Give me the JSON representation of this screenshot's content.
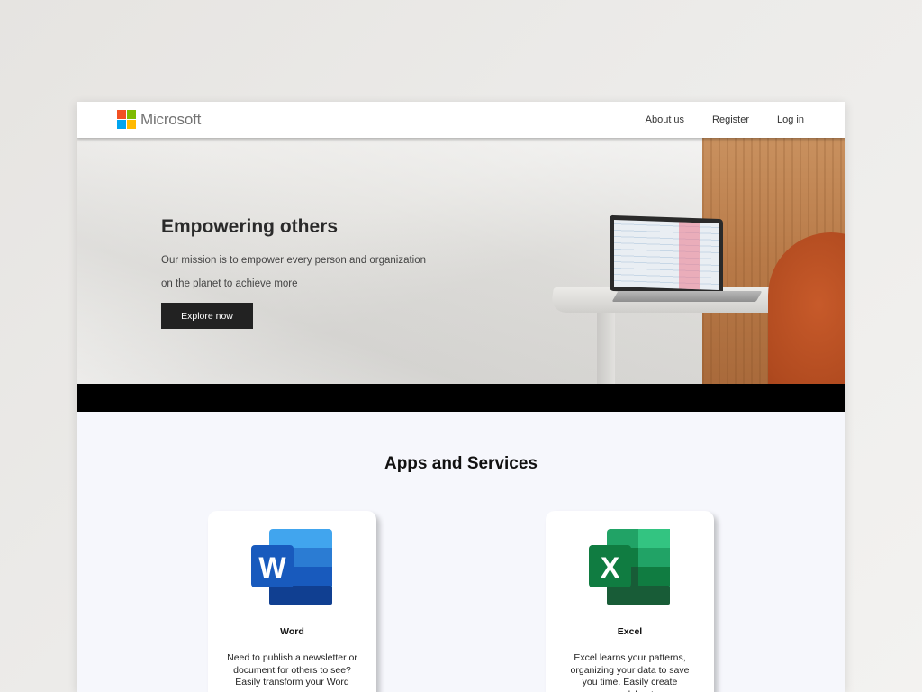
{
  "header": {
    "brand": "Microsoft",
    "logo_colors": [
      "#f25022",
      "#7fba00",
      "#00a4ef",
      "#ffb900"
    ],
    "nav": [
      "About us",
      "Register",
      "Log in"
    ]
  },
  "hero": {
    "title": "Empowering others",
    "line1": "Our mission is to empower every person and organization",
    "line2": "on the planet to achieve more",
    "button": "Explore now"
  },
  "apps": {
    "title": "Apps and Services",
    "cards": [
      {
        "name": "Word",
        "icon": "word-icon",
        "letter": "W",
        "color": "#185abd",
        "description": "Need to publish a newsletter or document for others to see? Easily transform your Word"
      },
      {
        "name": "Excel",
        "icon": "excel-icon",
        "letter": "X",
        "color": "#107c41",
        "description": "Excel learns your patterns, organizing your data to save you time. Easily create spreadsheets"
      }
    ]
  }
}
